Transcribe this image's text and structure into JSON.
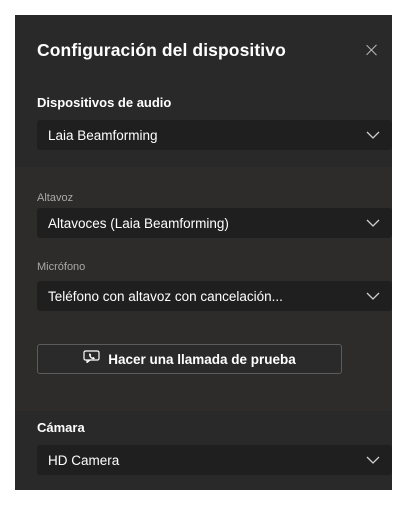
{
  "panel": {
    "title": "Configuración del dispositivo",
    "close_icon": "close-icon"
  },
  "audio_devices": {
    "label": "Dispositivos de audio",
    "selected": "Laia Beamforming"
  },
  "speaker": {
    "label": "Altavoz",
    "selected": "Altavoces (Laia Beamforming)"
  },
  "microphone": {
    "label": "Micrófono",
    "selected": "Teléfono con altavoz con cancelación..."
  },
  "test_call": {
    "label": "Hacer una llamada de prueba",
    "icon": "test-call-icon"
  },
  "camera": {
    "label": "Cámara",
    "selected": "HD Camera"
  },
  "colors": {
    "panel_bg": "#292929",
    "inner_bg": "#2e2c2a",
    "dropdown_bg": "#1f1f1f",
    "text": "#ffffff",
    "muted_text": "#a8a8a8"
  }
}
